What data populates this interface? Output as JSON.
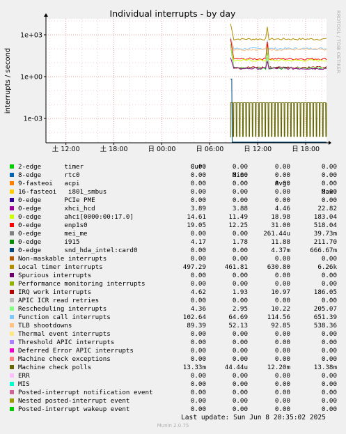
{
  "title": "Individual interrupts - by day",
  "ylabel": "interrupts / second",
  "side_label": "RRDTOOL / TOBI OETIKER",
  "x_ticks": [
    "土 12:00",
    "土 18:00",
    "日 00:00",
    "日 06:00",
    "日 12:00",
    "日 18:00"
  ],
  "y_ticks": [
    "1e+03",
    "1e+00",
    "1e-03"
  ],
  "headers": {
    "cur": "Cur:",
    "min": "Min:",
    "avg": "Avg:",
    "max": "Max:"
  },
  "legend": [
    {
      "name": "2-edge      timer",
      "color": "#00cc00",
      "cur": "0.00",
      "min": "0.00",
      "avg": "0.00",
      "max": "0.00"
    },
    {
      "name": "8-edge      rtc0",
      "color": "#0066b3",
      "cur": "0.00",
      "min": "0.00",
      "avg": "0.00",
      "max": "0.00"
    },
    {
      "name": "9-fasteoi   acpi",
      "color": "#ff8000",
      "cur": "0.00",
      "min": "0.00",
      "avg": "0.00",
      "max": "0.00"
    },
    {
      "name": "16-fasteoi   i801_smbus",
      "color": "#ffcc00",
      "cur": "0.00",
      "min": "0.00",
      "avg": "0.00",
      "max": "0.00"
    },
    {
      "name": "0-edge      PCIe PME",
      "color": "#330099",
      "cur": "0.00",
      "min": "0.00",
      "avg": "0.00",
      "max": "0.00"
    },
    {
      "name": "0-edge      xhci_hcd",
      "color": "#990099",
      "cur": "3.89",
      "min": "3.88",
      "avg": "4.46",
      "max": "22.82"
    },
    {
      "name": "0-edge      ahci[0000:00:17.0]",
      "color": "#ccff00",
      "cur": "14.61",
      "min": "11.49",
      "avg": "18.98",
      "max": "183.04"
    },
    {
      "name": "0-edge      enp1s0",
      "color": "#ff0000",
      "cur": "19.05",
      "min": "12.25",
      "avg": "31.00",
      "max": "518.04"
    },
    {
      "name": "0-edge      mei_me",
      "color": "#808080",
      "cur": "0.00",
      "min": "0.00",
      "avg": "261.44u",
      "max": "39.73m"
    },
    {
      "name": "0-edge      i915",
      "color": "#008f00",
      "cur": "4.17",
      "min": "1.78",
      "avg": "11.88",
      "max": "211.70"
    },
    {
      "name": "0-edge      snd_hda_intel:card0",
      "color": "#00487d",
      "cur": "0.00",
      "min": "0.00",
      "avg": "4.37m",
      "max": "666.67m"
    },
    {
      "name": "Non-maskable interrupts",
      "color": "#b35a00",
      "cur": "0.00",
      "min": "0.00",
      "avg": "0.00",
      "max": "0.00"
    },
    {
      "name": "Local timer interrupts",
      "color": "#b38f00",
      "cur": "497.29",
      "min": "461.81",
      "avg": "630.80",
      "max": "6.26k"
    },
    {
      "name": "Spurious interrupts",
      "color": "#6b006b",
      "cur": "0.00",
      "min": "0.00",
      "avg": "0.00",
      "max": "0.00"
    },
    {
      "name": "Performance monitoring interrupts",
      "color": "#8fb300",
      "cur": "0.00",
      "min": "0.00",
      "avg": "0.00",
      "max": "0.00"
    },
    {
      "name": "IRQ work interrupts",
      "color": "#b30000",
      "cur": "4.62",
      "min": "1.93",
      "avg": "10.97",
      "max": "186.05"
    },
    {
      "name": "APIC ICR read retries",
      "color": "#bebebe",
      "cur": "0.00",
      "min": "0.00",
      "avg": "0.00",
      "max": "0.00"
    },
    {
      "name": "Rescheduling interrupts",
      "color": "#80ff80",
      "cur": "4.36",
      "min": "2.95",
      "avg": "10.22",
      "max": "205.07"
    },
    {
      "name": "Function call interrupts",
      "color": "#80c9ff",
      "cur": "102.64",
      "min": "64.69",
      "avg": "114.56",
      "max": "651.39"
    },
    {
      "name": "TLB shootdowns",
      "color": "#ffc080",
      "cur": "89.39",
      "min": "52.13",
      "avg": "92.85",
      "max": "538.36"
    },
    {
      "name": "Thermal event interrupts",
      "color": "#ffe680",
      "cur": "0.00",
      "min": "0.00",
      "avg": "0.00",
      "max": "0.00"
    },
    {
      "name": "Threshold APIC interrupts",
      "color": "#aa80ff",
      "cur": "0.00",
      "min": "0.00",
      "avg": "0.00",
      "max": "0.00"
    },
    {
      "name": "Deferred Error APIC interrupts",
      "color": "#ee00cc",
      "cur": "0.00",
      "min": "0.00",
      "avg": "0.00",
      "max": "0.00"
    },
    {
      "name": "Machine check exceptions",
      "color": "#ff8080",
      "cur": "0.00",
      "min": "0.00",
      "avg": "0.00",
      "max": "0.00"
    },
    {
      "name": "Machine check polls",
      "color": "#666600",
      "cur": "13.33m",
      "min": "44.44u",
      "avg": "12.20m",
      "max": "13.38m"
    },
    {
      "name": "ERR",
      "color": "#ffbfff",
      "cur": "0.00",
      "min": "0.00",
      "avg": "0.00",
      "max": "0.00"
    },
    {
      "name": "MIS",
      "color": "#00ffcc",
      "cur": "0.00",
      "min": "0.00",
      "avg": "0.00",
      "max": "0.00"
    },
    {
      "name": "Posted-interrupt notification event",
      "color": "#cc6699",
      "cur": "0.00",
      "min": "0.00",
      "avg": "0.00",
      "max": "0.00"
    },
    {
      "name": "Nested posted-interrupt event",
      "color": "#999900",
      "cur": "0.00",
      "min": "0.00",
      "avg": "0.00",
      "max": "0.00"
    },
    {
      "name": "Posted-interrupt wakeup event",
      "color": "#00cc00",
      "cur": "0.00",
      "min": "0.00",
      "avg": "0.00",
      "max": "0.00"
    }
  ],
  "last_update": "Last update: Sun Jun  8 20:35:02 2025",
  "footer": "Munin 2.0.75",
  "chart_data": {
    "type": "line",
    "title": "Individual interrupts - by day",
    "ylabel": "interrupts / second",
    "y_scale": "log",
    "y_ticks": [
      1000,
      1,
      0.001
    ],
    "x_ticks": [
      "土 12:00",
      "土 18:00",
      "日 00:00",
      "日 06:00",
      "日 12:00",
      "日 18:00"
    ],
    "x_range_hours": [
      9.5,
      44.6
    ],
    "data_start_hour": 32.6,
    "grid": true,
    "series": [
      {
        "name": "Local timer interrupts",
        "color": "#b38f00",
        "level": 497.29,
        "peak": 6260
      },
      {
        "name": "Function call interrupts",
        "color": "#80c9ff",
        "level": 102.64,
        "peak": 651.39
      },
      {
        "name": "TLB shootdowns",
        "color": "#ffc080",
        "level": 89.39,
        "peak": 538.36
      },
      {
        "name": "0-edge      enp1s0",
        "color": "#ff0000",
        "level": 19.05,
        "peak": 518.04
      },
      {
        "name": "0-edge      ahci[0000:00:17.0]",
        "color": "#ccff00",
        "level": 14.61,
        "peak": 183.04
      },
      {
        "name": "0-edge      i915",
        "color": "#008f00",
        "level": 4.17,
        "peak": 211.7
      },
      {
        "name": "IRQ work interrupts",
        "color": "#b30000",
        "level": 4.62,
        "peak": 186.05
      },
      {
        "name": "Rescheduling interrupts",
        "color": "#80ff80",
        "level": 4.36,
        "peak": 205.07
      },
      {
        "name": "0-edge      xhci_hcd",
        "color": "#990099",
        "level": 3.89,
        "peak": 22.82
      },
      {
        "name": "0-edge      snd_hda_intel:card0",
        "color": "#00487d",
        "level": 0.004,
        "peak": 0.667
      },
      {
        "name": "Machine check polls",
        "color": "#666600",
        "level": 0.0133,
        "min": 4.44e-05,
        "peak": 0.0134
      }
    ]
  }
}
